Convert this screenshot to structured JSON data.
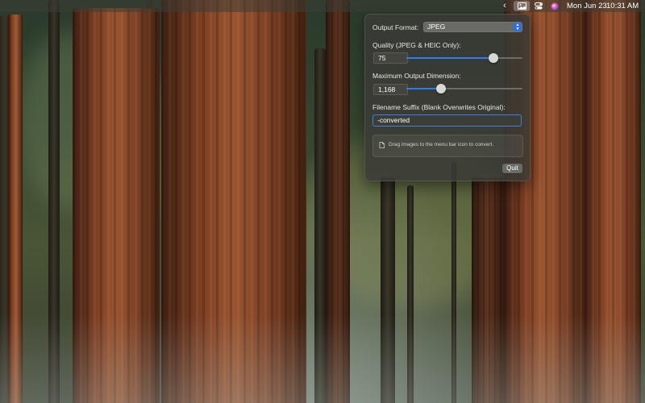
{
  "menubar": {
    "chevron": "‹",
    "date": "Mon Jun 23",
    "time": "10:31 AM",
    "icons": [
      "chevron-left-icon",
      "image-converter-icon",
      "control-center-icon",
      "siri-icon"
    ]
  },
  "popover": {
    "output_format_label": "Output Format:",
    "output_format_value": "JPEG",
    "quality_label": "Quality (JPEG & HEIC Only):",
    "quality_value": "75",
    "quality_level": 0.75,
    "max_dimension_label": "Maximum Output Dimension:",
    "max_dimension_value": "1,168",
    "max_dimension_level": 0.3,
    "suffix_label": "Filename Suffix (Blank Overwrites Original):",
    "suffix_value": "-converted",
    "info_text": "Drag images to the menu bar icon to convert.",
    "quit_label": "Quit"
  },
  "colors": {
    "accent": "#2f7bf0",
    "panel_bg": "#3a3a36",
    "focus_ring": "#3e7fe6"
  }
}
